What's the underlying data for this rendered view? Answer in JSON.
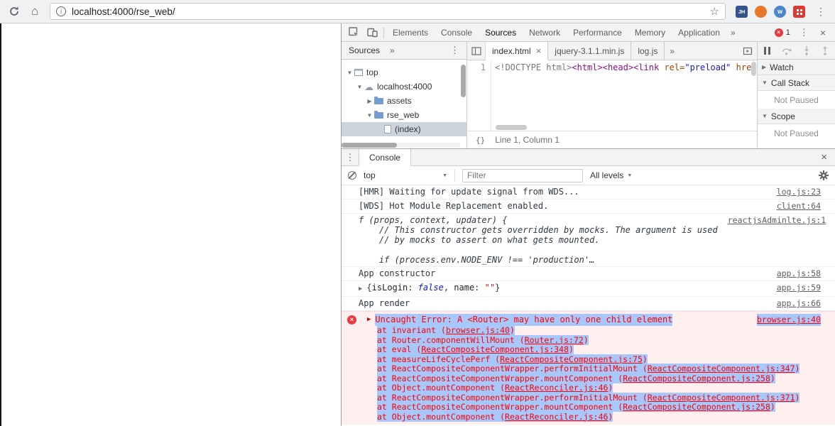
{
  "icons": {
    "kebab": "⋮",
    "close": "×",
    "more_tabs": "»",
    "star": "☆",
    "cloud": "☁",
    "home": "⌂",
    "dropdown_arrow": "▼",
    "info": "i",
    "error_x": "×",
    "pretty_print": "{}"
  },
  "browser": {
    "url": "localhost:4000/rse_web/",
    "extensions": [
      {
        "label": "JH",
        "bg": "#33538c",
        "shape": "square"
      },
      {
        "label": "",
        "bg": "#e8772a",
        "shape": "circle"
      },
      {
        "label": "W",
        "bg": "#4a86c8",
        "shape": "circle"
      },
      {
        "label": "",
        "bg": "#d93b30",
        "shape": "square",
        "grid": true
      }
    ]
  },
  "devtools": {
    "tabs": [
      "Elements",
      "Console",
      "Sources",
      "Network",
      "Performance",
      "Memory",
      "Application"
    ],
    "selected_tab": "Sources",
    "error_count": "1",
    "sources": {
      "navigator_tab": "Sources",
      "tree": [
        {
          "indent": 0,
          "arrow": "▼",
          "icon": "frame",
          "label": "top"
        },
        {
          "indent": 1,
          "arrow": "▼",
          "icon": "cloud",
          "label": "localhost:4000"
        },
        {
          "indent": 2,
          "arrow": "▶",
          "icon": "folder",
          "label": "assets"
        },
        {
          "indent": 2,
          "arrow": "▼",
          "icon": "folder",
          "label": "rse_web"
        },
        {
          "indent": 3,
          "arrow": "",
          "icon": "file",
          "label": "(index)",
          "selected": true
        }
      ],
      "editor_tabs": [
        {
          "label": "index.html",
          "selected": true,
          "close": "×"
        },
        {
          "label": "jquery-3.1.1.min.js"
        },
        {
          "label": "log.js"
        }
      ],
      "line_number": "1",
      "code_tokens": [
        {
          "t": "<!DOCTYPE html>",
          "c": "doctype"
        },
        {
          "t": "<html>",
          "c": "tag"
        },
        {
          "t": "<head>",
          "c": "tag"
        },
        {
          "t": "<link",
          "c": "tag"
        },
        {
          "t": " ",
          "c": "plain"
        },
        {
          "t": "rel=",
          "c": "attr"
        },
        {
          "t": "\"preload\"",
          "c": "value"
        },
        {
          "t": " ",
          "c": "plain"
        },
        {
          "t": "href",
          "c": "attr"
        }
      ],
      "status": "Line 1, Column 1"
    },
    "debugger": {
      "sections": [
        {
          "arrow": "▶",
          "label": "Watch"
        },
        {
          "arrow": "▼",
          "label": "Call Stack",
          "content": "Not Paused"
        },
        {
          "arrow": "▼",
          "label": "Scope",
          "content": "Not Paused"
        }
      ]
    },
    "console": {
      "tab": "Console",
      "context": "top",
      "filter_placeholder": "Filter",
      "levels": "All levels",
      "messages": [
        {
          "type": "log",
          "text": "[HMR] Waiting for update signal from WDS...",
          "link": "log.js:23"
        },
        {
          "type": "log",
          "text": "[WDS] Hot Module Replacement enabled.",
          "link": "client:64"
        },
        {
          "type": "func",
          "lines": [
            "f (props, context, updater) {",
            "    // This constructor gets overridden by mocks. The argument is used",
            "    // by mocks to assert on what gets mounted.",
            "",
            "    if (process.env.NODE_ENV !== 'production'…"
          ],
          "link": "reactjsAdminlte.js:1"
        },
        {
          "type": "log",
          "text": "App constructor",
          "link": "app.js:58"
        },
        {
          "type": "object",
          "expander": "▶",
          "preview": [
            {
              "key": "isLogin",
              "value": "false",
              "vclass": "bool"
            },
            {
              "key": "name",
              "value": "\"\"",
              "vclass": "string"
            }
          ],
          "link": "app.js:59"
        },
        {
          "type": "log",
          "text": "App render",
          "link": "app.js:66"
        },
        {
          "type": "error",
          "expander": "▶",
          "text": "Uncaught Error: A <Router> may have only one child element",
          "link": "browser.js:40",
          "stack": [
            {
              "pre": "at invariant (",
              "link": "browser.js:40",
              "post": ")"
            },
            {
              "pre": "at Router.componentWillMount (",
              "link": "Router.js:72",
              "post": ")"
            },
            {
              "pre": "at eval (",
              "link": "ReactCompositeComponent.js:348",
              "post": ")"
            },
            {
              "pre": "at measureLifeCyclePerf (",
              "link": "ReactCompositeComponent.js:75",
              "post": ")"
            },
            {
              "pre": "at ReactCompositeComponentWrapper.performInitialMount (",
              "link": "ReactCompositeComponent.js:347",
              "post": ")"
            },
            {
              "pre": "at ReactCompositeComponentWrapper.mountComponent (",
              "link": "ReactCompositeComponent.js:258",
              "post": ")"
            },
            {
              "pre": "at Object.mountComponent (",
              "link": "ReactReconciler.js:46",
              "post": ")"
            },
            {
              "pre": "at ReactCompositeComponentWrapper.performInitialMount (",
              "link": "ReactCompositeComponent.js:371",
              "post": ")"
            },
            {
              "pre": "at ReactCompositeComponentWrapper.mountComponent (",
              "link": "ReactCompositeComponent.js:258",
              "post": ")"
            },
            {
              "pre": "at Object.mountComponent (",
              "link": "ReactReconciler.js:46",
              "post": ")"
            }
          ]
        }
      ]
    }
  }
}
